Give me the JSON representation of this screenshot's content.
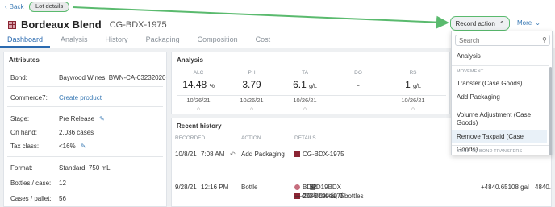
{
  "header": {
    "back_label": "Back",
    "breadcrumb": "Lot details",
    "title": "Bordeaux Blend",
    "code": "CG-BDX-1975",
    "record_action_label": "Record action",
    "more_label": "More"
  },
  "tabs": [
    "Dashboard",
    "Analysis",
    "History",
    "Packaging",
    "Composition",
    "Cost"
  ],
  "attributes": {
    "title": "Attributes",
    "rows": [
      {
        "label": "Bond:",
        "value": "Baywood Wines, BWN-CA-03232020"
      },
      {
        "label": "Commerce7:",
        "value": "Create product"
      },
      {
        "label": "Stage:",
        "value": "Pre Release"
      },
      {
        "label": "On hand:",
        "value": "2,036 cases"
      },
      {
        "label": "Tax class:",
        "value": "<16%"
      },
      {
        "label": "Format:",
        "value": "Standard: 750 mL"
      },
      {
        "label": "Bottles / case:",
        "value": "12"
      },
      {
        "label": "Cases / pallet:",
        "value": "56"
      }
    ]
  },
  "analysis": {
    "title": "Analysis",
    "metrics": [
      {
        "label": "ALC",
        "value": "14.48",
        "unit": "%",
        "date": "10/26/21"
      },
      {
        "label": "PH",
        "value": "3.79",
        "unit": "",
        "date": "10/26/21"
      },
      {
        "label": "TA",
        "value": "6.1",
        "unit": "g/L",
        "date": "10/26/21"
      },
      {
        "label": "DO",
        "value": "-",
        "unit": "",
        "date": ""
      },
      {
        "label": "RS",
        "value": "1",
        "unit": "g/L",
        "date": "10/26/21"
      }
    ]
  },
  "history": {
    "title": "Recent history",
    "columns": [
      "RECORDED",
      "ACTION",
      "DETAILS"
    ],
    "rows": [
      {
        "date": "10/8/21",
        "time": "7:08 AM",
        "action": "Add Packaging",
        "detail": "CG-BDX-1975",
        "amount": ""
      },
      {
        "date": "9/28/21",
        "time": "12:16 PM",
        "action": "Bottle",
        "detail": "BDRD19BDX",
        "count": "52",
        "detail2": "CG-BDX-1975",
        "note_label": "Bordeaux Blend:",
        "note": "2036 cases, 0 bottles",
        "amount": "+4840.65108 gal",
        "amount2": "4840."
      }
    ]
  },
  "dropdown": {
    "search_placeholder": "Search",
    "items": [
      {
        "label": "Analysis"
      },
      {
        "section": "MOVEMENT"
      },
      {
        "label": "Transfer (Case Goods)"
      },
      {
        "label": "Add Packaging"
      },
      {
        "label": "Volume Adjustment (Case Goods)"
      },
      {
        "label": "Remove Taxpaid (Case Goods)"
      },
      {
        "section": "BOND TO BOND TRANSFERS"
      }
    ]
  },
  "colors": {
    "accent": "#2a6ab0",
    "highlight_green": "#5aba6e",
    "lot_color": "#8b2533"
  }
}
